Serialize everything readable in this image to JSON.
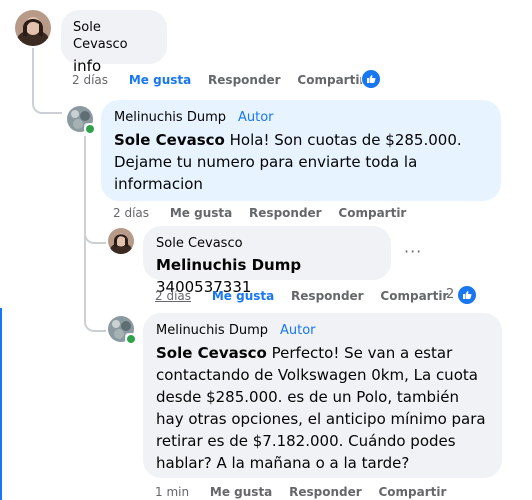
{
  "comments": [
    {
      "author": "Sole Cevasco",
      "text": "info",
      "time": "2 días",
      "like": "Me gusta",
      "reply": "Responder",
      "share": "Compartir"
    },
    {
      "author": "Melinuchis Dump",
      "badge": "Autor",
      "mention": "Sole Cevasco",
      "text": " Hola! Son cuotas de $285.000. Dejame tu numero para enviarte toda la informacion",
      "time": "2 días",
      "like": "Me gusta",
      "reply": "Responder",
      "share": "Compartir"
    },
    {
      "author": "Sole Cevasco",
      "mention": "Melinuchis Dump",
      "text": " 3400537331",
      "time": "2 días",
      "like": "Me gusta",
      "reply": "Responder",
      "share": "Compartir",
      "reactions": "2"
    },
    {
      "author": "Melinuchis Dump",
      "badge": "Autor",
      "mention": "Sole Cevasco",
      "text": " Perfecto! Se van a estar contactando de Volkswagen 0km, La cuota desde $285.000. es de un Polo, también hay otras opciones, el anticipo mínimo para retirar es de $7.182.000. Cuándo podes hablar? A la mañana o a la tarde?",
      "time": "1 min",
      "like": "Me gusta",
      "reply": "Responder",
      "share": "Compartir"
    }
  ],
  "colors": {
    "link_blue": "#1877f2",
    "author_bubble": "#e7f3ff",
    "bubble_gray": "#f0f2f5",
    "meta_gray": "#65676b",
    "online": "#31a24c"
  },
  "icons": {
    "like_badge": "thumbs-up-icon",
    "more": "more-options-icon"
  },
  "more_glyph": "···"
}
